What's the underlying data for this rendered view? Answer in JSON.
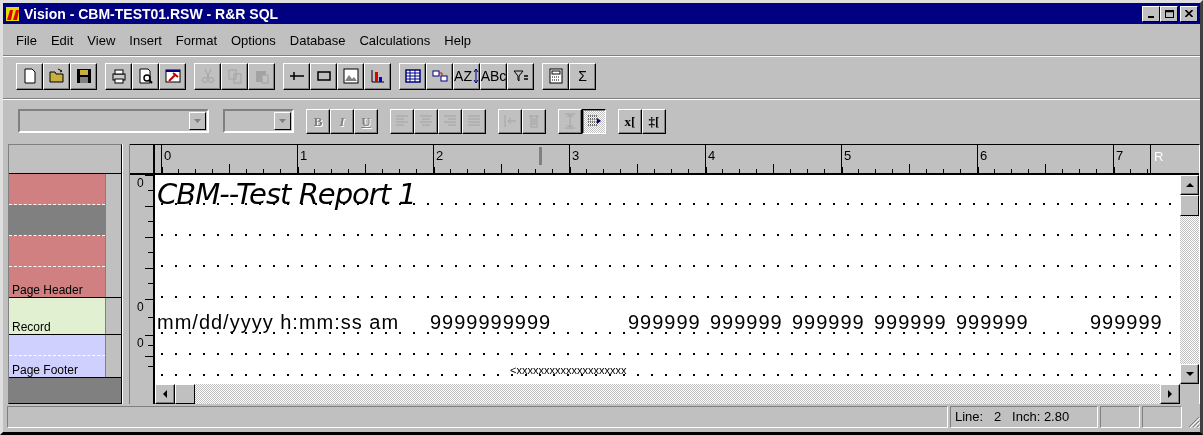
{
  "window": {
    "title": "Vision - CBM-TEST01.RSW - R&R SQL"
  },
  "menu": [
    {
      "label": "File"
    },
    {
      "label": "Edit"
    },
    {
      "label": "View"
    },
    {
      "label": "Insert"
    },
    {
      "label": "Format"
    },
    {
      "label": "Options"
    },
    {
      "label": "Database"
    },
    {
      "label": "Calculations"
    },
    {
      "label": "Help"
    }
  ],
  "toolbar": [
    [
      {
        "kind": "new",
        "disabled": false
      },
      {
        "kind": "open",
        "disabled": false
      },
      {
        "kind": "save",
        "disabled": false
      }
    ],
    [
      {
        "kind": "print",
        "disabled": false
      },
      {
        "kind": "preview",
        "disabled": false
      },
      {
        "kind": "wizard",
        "disabled": false
      }
    ],
    [
      {
        "kind": "cut",
        "disabled": true
      },
      {
        "kind": "copy",
        "disabled": true
      },
      {
        "kind": "paste",
        "disabled": true
      }
    ],
    [
      {
        "kind": "line",
        "disabled": false
      },
      {
        "kind": "box",
        "disabled": false
      },
      {
        "kind": "image",
        "disabled": false
      },
      {
        "kind": "chart",
        "disabled": false
      }
    ],
    [
      {
        "kind": "table",
        "disabled": false
      },
      {
        "kind": "relation",
        "disabled": false
      },
      {
        "kind": "sort",
        "disabled": false,
        "glyph": "AZ"
      },
      {
        "kind": "text",
        "disabled": false,
        "glyph": "ABc"
      },
      {
        "kind": "filter",
        "disabled": false
      }
    ],
    [
      {
        "kind": "calculator",
        "disabled": false
      },
      {
        "kind": "text",
        "disabled": false,
        "glyph": "Σ"
      }
    ]
  ],
  "format_bar": {
    "groups": [
      [
        {
          "kind": "bold",
          "disabled": true,
          "pressed": false,
          "glyph": "B"
        },
        {
          "kind": "italic",
          "disabled": true,
          "pressed": false,
          "glyph": "I"
        },
        {
          "kind": "underline",
          "disabled": true,
          "pressed": false,
          "glyph": "U"
        }
      ],
      [
        {
          "kind": "align-left",
          "disabled": true,
          "pressed": false
        },
        {
          "kind": "align-center",
          "disabled": true,
          "pressed": false
        },
        {
          "kind": "align-right",
          "disabled": true,
          "pressed": false
        },
        {
          "kind": "justify",
          "disabled": true,
          "pressed": false
        }
      ],
      [
        {
          "kind": "indent",
          "disabled": true,
          "pressed": false
        },
        {
          "kind": "trash",
          "disabled": true,
          "pressed": false
        }
      ],
      [
        {
          "kind": "spacing",
          "disabled": true,
          "pressed": false
        },
        {
          "kind": "grid",
          "disabled": false,
          "pressed": true
        }
      ],
      [
        {
          "kind": "bold",
          "disabled": false,
          "pressed": false,
          "glyph": "x["
        },
        {
          "kind": "bold",
          "disabled": false,
          "pressed": false,
          "glyph": "‡["
        }
      ]
    ]
  },
  "ruler": {
    "marks": [
      "0",
      "1",
      "2",
      "3",
      "4",
      "5",
      "6",
      "7"
    ],
    "end": "R"
  },
  "bands": [
    {
      "name": "Page Header",
      "color": "#d08080",
      "ruler_label": "0",
      "lines": [
        {
          "selected": false,
          "items": [
            {
              "kind": "title",
              "text": "CBM--Test Report 1"
            }
          ]
        },
        {
          "selected": true
        },
        {
          "selected": false
        },
        {
          "selected": false
        }
      ]
    },
    {
      "name": "Record",
      "color": "#e0f0d0",
      "ruler_label": "0",
      "lines": [
        {
          "selected": false,
          "items": [
            {
              "kind": "field",
              "text": "mm/dd/yyyy h:mm:ss am"
            },
            {
              "kind": "field",
              "text": "9999999999"
            },
            {
              "kind": "field",
              "text": "999999"
            },
            {
              "kind": "field",
              "text": "999999"
            },
            {
              "kind": "field",
              "text": "999999"
            },
            {
              "kind": "field",
              "text": "999999"
            },
            {
              "kind": "field",
              "text": "999999"
            },
            {
              "kind": "field",
              "text": "999999"
            }
          ]
        }
      ]
    },
    {
      "name": "Page Footer",
      "color": "#d0d0ff",
      "ruler_label": "0",
      "lines": [
        {
          "selected": false
        },
        {
          "selected": false,
          "items": [
            {
              "kind": "small",
              "text": "<xxxxxxxxxxxxxxxxxxxx"
            }
          ]
        }
      ]
    }
  ],
  "status_bar": {
    "position": "Line:   2   Inch: 2.80"
  }
}
